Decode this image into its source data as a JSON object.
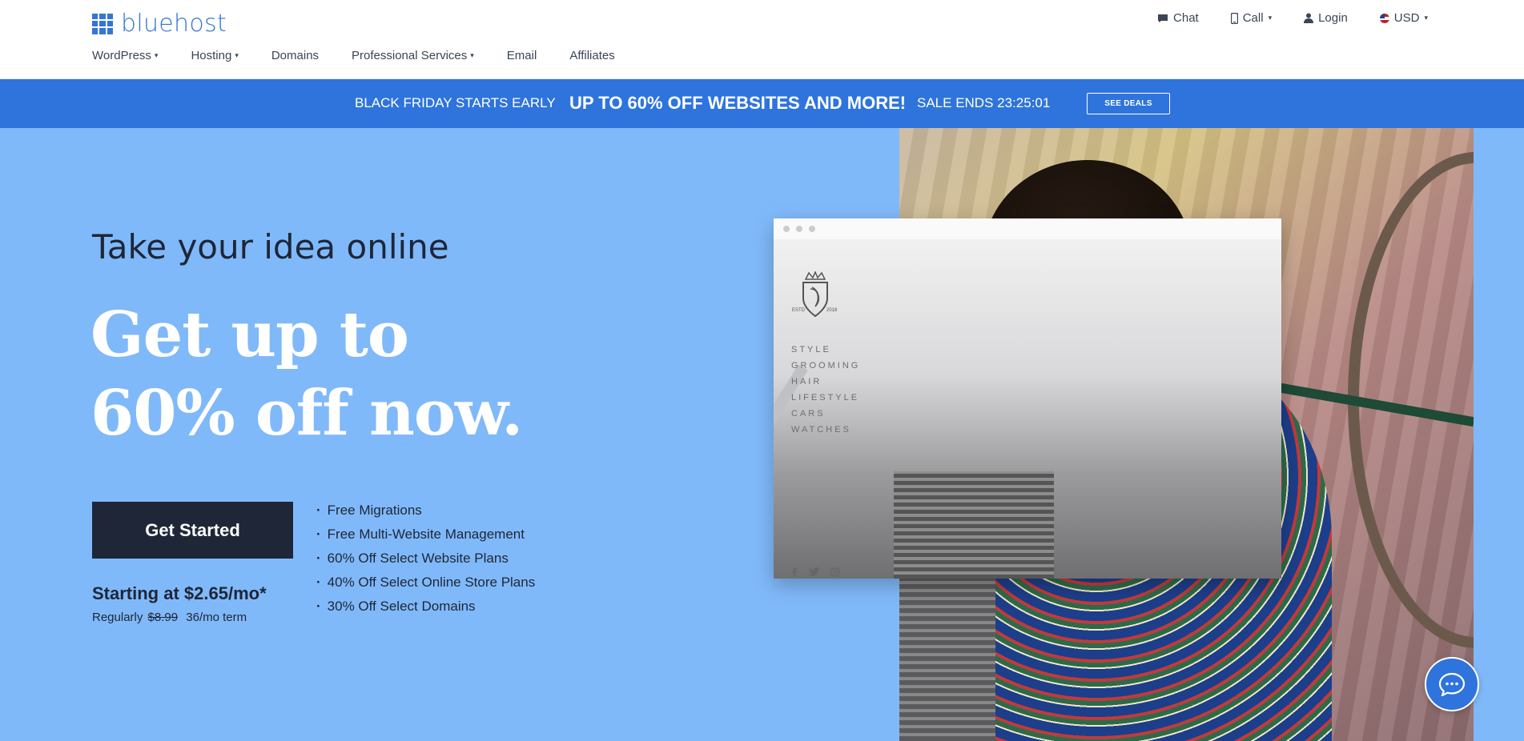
{
  "brand": {
    "name": "bluehost",
    "accent": "#3575d3"
  },
  "util_nav": {
    "chat": "Chat",
    "call": "Call",
    "login": "Login",
    "currency": "USD"
  },
  "main_nav": {
    "items": [
      {
        "label": "WordPress",
        "has_dropdown": true
      },
      {
        "label": "Hosting",
        "has_dropdown": true
      },
      {
        "label": "Domains",
        "has_dropdown": false
      },
      {
        "label": "Professional Services",
        "has_dropdown": true
      },
      {
        "label": "Email",
        "has_dropdown": false
      },
      {
        "label": "Affiliates",
        "has_dropdown": false
      }
    ]
  },
  "banner": {
    "lead": "BLACK FRIDAY STARTS EARLY",
    "headline": "UP TO 60% OFF WEBSITES AND MORE!",
    "countdown": "SALE ENDS 23:25:01",
    "button": "SEE DEALS",
    "color": "#2f74dc"
  },
  "hero": {
    "kicker": "Take your idea online",
    "headline_line1": "Get up to",
    "headline_line2": "60% off now.",
    "cta": "Get Started",
    "price_main": "Starting at $2.65/mo*",
    "price_regularly": "Regularly",
    "price_old": "$8.99",
    "price_term": "36/mo term",
    "features": [
      "Free Migrations",
      "Free Multi-Website Management",
      "60% Off Select Website Plans",
      "40% Off Select Online Store Plans",
      "30% Off Select Domains"
    ],
    "background": "#80b9fa"
  },
  "mockup": {
    "crest_text_left": "ESTD",
    "crest_text_right": "2018",
    "menu": [
      "STYLE",
      "GROOMING",
      "HAIR",
      "LIFESTYLE",
      "CARS",
      "WATCHES"
    ]
  },
  "icons": {
    "chat": "chat-icon",
    "phone": "phone-icon",
    "user": "user-icon",
    "flag": "us-flag-icon",
    "chat_fab": "chat-bubble-icon"
  }
}
